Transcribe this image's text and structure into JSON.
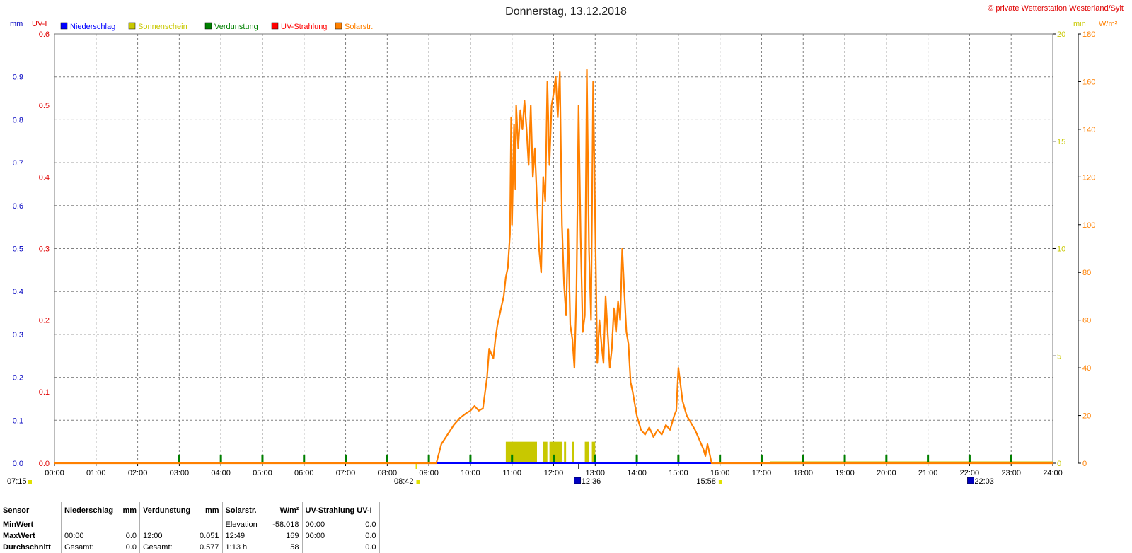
{
  "header": {
    "title": "Donnerstag, 13.12.2018",
    "copyright": "© private Wetterstation Westerland/Sylt"
  },
  "axes_units": {
    "left_outer": "mm",
    "left_inner": "UV-I",
    "right_inner": "min",
    "right_outer": "W/m²"
  },
  "legend": [
    {
      "label": "Niederschlag",
      "color": "#0000ff"
    },
    {
      "label": "Sonnenschein",
      "color": "#c8c800"
    },
    {
      "label": "Verdunstung",
      "color": "#008000"
    },
    {
      "label": "UV-Strahlung",
      "color": "#ff0000"
    },
    {
      "label": "Solarstr.",
      "color": "#ff8000"
    }
  ],
  "time_markers": [
    {
      "label": "07:15",
      "hour": 0,
      "icon": "sunrise-icon"
    },
    {
      "label": "08:42",
      "hour": 8.7,
      "icon": "sunrise-icon"
    },
    {
      "label": "12:36",
      "hour": 12.6,
      "icon": "moon-icon"
    },
    {
      "label": "15:58",
      "hour": 15.97,
      "icon": "sunset-icon"
    },
    {
      "label": "22:03",
      "hour": 22.05,
      "icon": "moon-icon"
    }
  ],
  "chart_data": {
    "type": "line",
    "title": "Donnerstag, 13.12.2018",
    "x_ticks": [
      "00:00",
      "01:00",
      "02:00",
      "03:00",
      "04:00",
      "05:00",
      "06:00",
      "07:00",
      "08:00",
      "09:00",
      "10:00",
      "11:00",
      "12:00",
      "13:00",
      "14:00",
      "15:00",
      "16:00",
      "17:00",
      "18:00",
      "19:00",
      "20:00",
      "21:00",
      "22:00",
      "23:00",
      "24:00"
    ],
    "xlim": [
      0,
      24
    ],
    "y_axes": {
      "mm": {
        "range": [
          0,
          1.0
        ],
        "ticks": [
          "0.0",
          "0.1",
          "0.2",
          "0.3",
          "0.4",
          "0.5",
          "0.6",
          "0.7",
          "0.8",
          "0.9"
        ],
        "color": "#0000c0"
      },
      "uvi": {
        "range": [
          0,
          0.6
        ],
        "ticks": [
          "0.0",
          "0.1",
          "0.2",
          "0.3",
          "0.4",
          "0.5",
          "0.6"
        ],
        "color": "#e00000"
      },
      "min": {
        "range": [
          0,
          20
        ],
        "ticks": [
          "0",
          "5",
          "10",
          "15",
          "20"
        ],
        "color": "#c8c800"
      },
      "wm2": {
        "range": [
          0,
          180
        ],
        "ticks": [
          "0",
          "20",
          "40",
          "60",
          "80",
          "100",
          "120",
          "140",
          "160",
          "180"
        ],
        "color": "#ff8000"
      }
    },
    "grid": true,
    "series": [
      {
        "name": "Solarstr.",
        "axis": "wm2",
        "color": "#ff8000",
        "x": [
          0,
          9.18,
          9.3,
          9.45,
          9.6,
          9.75,
          9.9,
          10.0,
          10.1,
          10.2,
          10.3,
          10.4,
          10.45,
          10.5,
          10.55,
          10.6,
          10.65,
          10.75,
          10.8,
          10.85,
          10.9,
          10.95,
          10.98,
          11.0,
          11.05,
          11.08,
          11.1,
          11.15,
          11.2,
          11.25,
          11.3,
          11.35,
          11.4,
          11.45,
          11.5,
          11.55,
          11.6,
          11.65,
          11.7,
          11.75,
          11.8,
          11.85,
          11.9,
          11.95,
          12.0,
          12.05,
          12.1,
          12.15,
          12.2,
          12.25,
          12.3,
          12.35,
          12.4,
          12.45,
          12.5,
          12.55,
          12.6,
          12.65,
          12.7,
          12.75,
          12.8,
          12.85,
          12.9,
          12.95,
          13.0,
          13.05,
          13.1,
          13.15,
          13.2,
          13.25,
          13.3,
          13.35,
          13.4,
          13.45,
          13.5,
          13.55,
          13.6,
          13.65,
          13.7,
          13.75,
          13.8,
          13.85,
          13.9,
          13.95,
          14.0,
          14.1,
          14.2,
          14.3,
          14.4,
          14.5,
          14.6,
          14.7,
          14.8,
          14.9,
          14.95,
          15.0,
          15.1,
          15.2,
          15.3,
          15.4,
          15.5,
          15.6,
          15.65,
          15.7,
          15.75,
          15.8,
          16.0,
          24.0
        ],
        "y": [
          0,
          0,
          8,
          12,
          16,
          19,
          21,
          22,
          24,
          22,
          23,
          36,
          48,
          46,
          44,
          52,
          58,
          66,
          70,
          78,
          82,
          96,
          145,
          100,
          142,
          115,
          150,
          132,
          148,
          140,
          152,
          140,
          125,
          150,
          120,
          132,
          110,
          90,
          80,
          120,
          110,
          160,
          125,
          150,
          155,
          162,
          145,
          164,
          100,
          75,
          62,
          98,
          58,
          52,
          40,
          72,
          150,
          95,
          55,
          62,
          165,
          90,
          60,
          160,
          100,
          42,
          60,
          50,
          42,
          70,
          55,
          40,
          48,
          65,
          55,
          68,
          60,
          90,
          72,
          55,
          50,
          34,
          30,
          25,
          20,
          14,
          12,
          15,
          11,
          14,
          12,
          16,
          14,
          20,
          22,
          40,
          26,
          20,
          17,
          14,
          10,
          6,
          3,
          8,
          4,
          0,
          0,
          0
        ]
      },
      {
        "name": "Sonnenschein",
        "axis": "min",
        "color": "#c8c800",
        "bars": [
          {
            "x0": 10.85,
            "x1": 11.6,
            "value": 1.0
          },
          {
            "x0": 11.75,
            "x1": 11.85,
            "value": 1.0
          },
          {
            "x0": 11.9,
            "x1": 12.2,
            "value": 1.0
          },
          {
            "x0": 12.25,
            "x1": 12.3,
            "value": 1.0
          },
          {
            "x0": 12.45,
            "x1": 12.5,
            "value": 1.0
          },
          {
            "x0": 12.75,
            "x1": 12.85,
            "value": 1.0
          },
          {
            "x0": 12.92,
            "x1": 13.0,
            "value": 1.0
          }
        ],
        "baseline": {
          "x0": 17.2,
          "x1": 24.0,
          "value": 0.05
        }
      },
      {
        "name": "Verdunstung",
        "axis": "mm",
        "color": "#008000",
        "hourly_marks": [
          3,
          4,
          5,
          6,
          7,
          8,
          9,
          10,
          11,
          12,
          13,
          14,
          15,
          16,
          17,
          18,
          19,
          20,
          21,
          22,
          23
        ],
        "mark_value": 0.02
      },
      {
        "name": "Niederschlag",
        "axis": "mm",
        "color": "#0000ff",
        "x": [
          0,
          24
        ],
        "y": [
          0,
          0
        ]
      }
    ]
  },
  "stats": {
    "headers": {
      "sensor": "Sensor",
      "niederschlag": "Niederschlag",
      "niederschlag_unit": "mm",
      "verdunstung": "Verdunstung",
      "verdunstung_unit": "mm",
      "solar": "Solarstr.",
      "solar_unit": "W/m²",
      "uv": "UV-Strahlung UV-I"
    },
    "rows": [
      {
        "label": "MinWert",
        "n_time": "",
        "n_val": "",
        "v_time": "",
        "v_val": "",
        "s_time": "Elevation",
        "s_val": "-58.018",
        "u_time": "00:00",
        "u_val": "0.0"
      },
      {
        "label": "MaxWert",
        "n_time": "00:00",
        "n_val": "0.0",
        "v_time": "12:00",
        "v_val": "0.051",
        "s_time": "12:49",
        "s_val": "169",
        "u_time": "00:00",
        "u_val": "0.0"
      },
      {
        "label": "Durchschnitt",
        "n_time": "Gesamt:",
        "n_val": "0.0",
        "v_time": "Gesamt:",
        "v_val": "0.577",
        "s_time": "1:13 h",
        "s_val": "58",
        "u_time": "",
        "u_val": "0.0"
      }
    ]
  }
}
